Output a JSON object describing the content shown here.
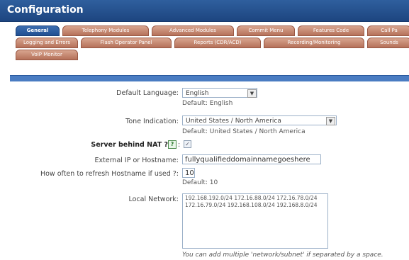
{
  "header": {
    "title": "Configuration"
  },
  "tabs": {
    "row1": [
      "General",
      "Telephony Modules",
      "Advanced Modules",
      "Commit Menu",
      "Features Code",
      "Call Pa"
    ],
    "row2": [
      "Logging and Errors",
      "Flash Operator Panel",
      "Reports (CDR/ACD)",
      "Recording/Monitoring",
      "Sounds"
    ],
    "row3": [
      "VoIP Monitor"
    ],
    "active": "General"
  },
  "form": {
    "default_language": {
      "label": "Default Language:",
      "value": "English",
      "default": "Default: English"
    },
    "tone_indication": {
      "label": "Tone Indication:",
      "value": "United States / North America",
      "default": "Default: United States / North America"
    },
    "server_behind_nat": {
      "label": "Server behind NAT ?",
      "separator": ":",
      "checked": true
    },
    "external_ip": {
      "label": "External IP or Hostname:",
      "value": "fullyqualifieddomainnamegoeshere"
    },
    "refresh_hostname": {
      "label": "How often to refresh Hostname if used ?:",
      "value": "10",
      "default": "Default: 10"
    },
    "local_network": {
      "label": "Local Network:",
      "value_line1": "192.168.192.0/24 172.16.88.0/24 172.16.78.0/24",
      "value_line2": "172.16.79.0/24 192.168.108.0/24 192.168.8.0/24",
      "note": "You can add multiple 'network/subnet' if separated by a space."
    }
  },
  "icons": {
    "help": "help-icon",
    "dropdown": "chevron-down-icon",
    "check": "checkbox-check-icon"
  }
}
